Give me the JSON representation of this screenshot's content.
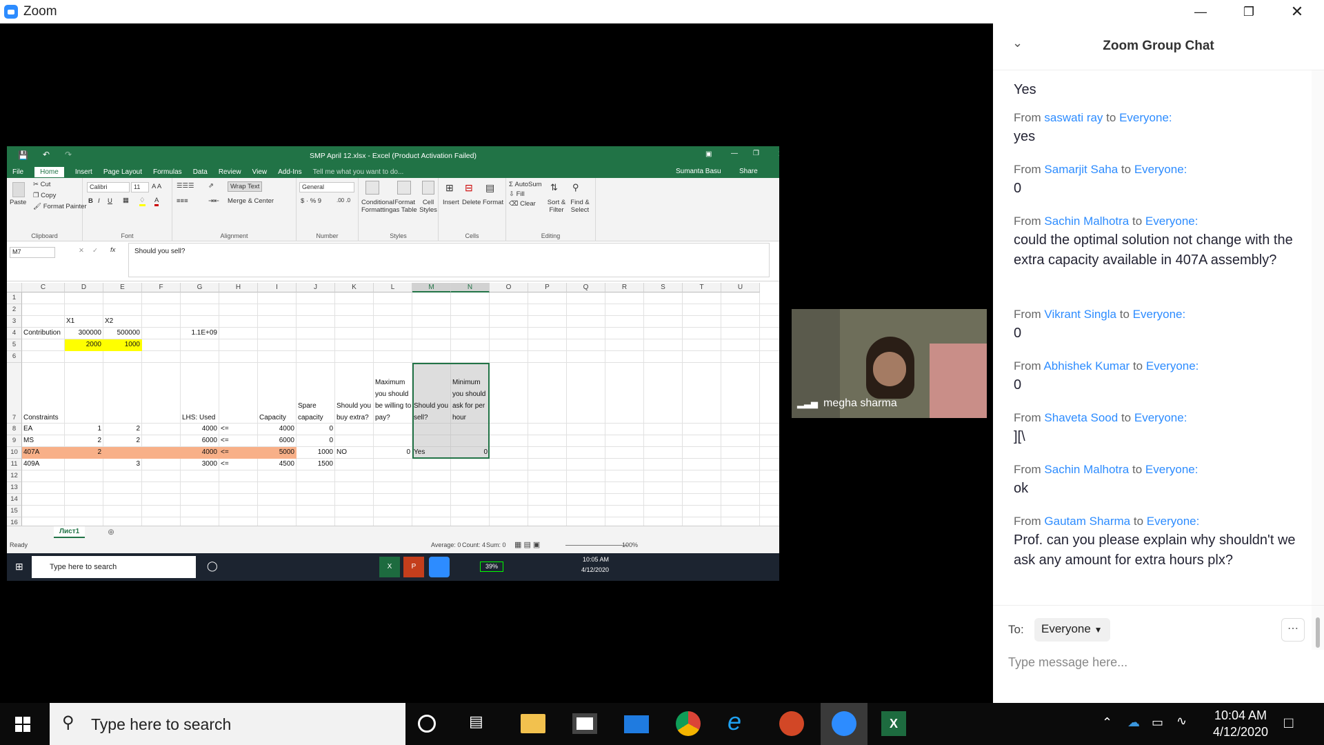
{
  "window": {
    "app_title": "Zoom"
  },
  "excel": {
    "title": "SMP April 12.xlsx - Excel (Product Activation Failed)",
    "tabs": [
      "File",
      "Home",
      "Insert",
      "Page Layout",
      "Formulas",
      "Data",
      "Review",
      "View",
      "Add-Ins"
    ],
    "tell_me": "Tell me what you want to do...",
    "user": "Sumanta Basu",
    "share": "Share",
    "ribbon": {
      "clipboard": {
        "paste": "Paste",
        "cut": "Cut",
        "copy": "Copy",
        "format_painter": "Format Painter",
        "label": "Clipboard"
      },
      "font": {
        "name": "Calibri",
        "size": "11",
        "label": "Font"
      },
      "alignment": {
        "wrap": "Wrap Text",
        "merge": "Merge & Center",
        "label": "Alignment"
      },
      "number": {
        "format": "General",
        "label": "Number"
      },
      "styles": {
        "cond": "Conditional Formatting",
        "table": "Format as Table",
        "cell": "Cell Styles",
        "label": "Styles"
      },
      "cells": {
        "insert": "Insert",
        "delete": "Delete",
        "format": "Format",
        "label": "Cells"
      },
      "editing": {
        "autosum": "AutoSum",
        "fill": "Fill",
        "clear": "Clear",
        "sort": "Sort & Filter",
        "find": "Find & Select",
        "label": "Editing"
      }
    },
    "name_box": "M7",
    "formula": "Should you sell?",
    "columns": [
      "C",
      "D",
      "E",
      "F",
      "G",
      "H",
      "I",
      "J",
      "K",
      "L",
      "M",
      "N",
      "O",
      "P",
      "Q",
      "R",
      "S",
      "T",
      "U"
    ],
    "rows": [
      "1",
      "2",
      "3",
      "4",
      "5",
      "6",
      "7",
      "8",
      "9",
      "10",
      "11",
      "12",
      "13",
      "14",
      "15",
      "16"
    ],
    "cells": {
      "D3": "X1",
      "E3": "X2",
      "C4": "Contribution",
      "D4": "300000",
      "E4": "500000",
      "G4": "1.1E+09",
      "D5": "2000",
      "E5": "1000",
      "C7": "Constraints",
      "G7": "LHS: Used",
      "I7": "Capacity",
      "J7": "Spare capacity",
      "K7": "Should you buy extra?",
      "L7": "Maximum you should be willing to pay?",
      "M7": "Should you sell?",
      "N7": "Minimum you should ask for per hour",
      "C8": "EA",
      "D8": "1",
      "E8": "2",
      "G8": "4000",
      "H8": "<=",
      "I8": "4000",
      "J8": "0",
      "C9": "MS",
      "D9": "2",
      "E9": "2",
      "G9": "6000",
      "H9": "<=",
      "I9": "6000",
      "J9": "0",
      "C10": "407A",
      "D10": "2",
      "G10": "4000",
      "H10": "<=",
      "I10": "5000",
      "J10": "1000",
      "K10": "NO",
      "L10": "0",
      "M10": "Yes",
      "N10": "0",
      "C11": "409A",
      "E11": "3",
      "G11": "3000",
      "H11": "<=",
      "I11": "4500",
      "J11": "1500"
    },
    "sheet_tab": "Лист1",
    "status": {
      "ready": "Ready",
      "average": "Average: 0",
      "count": "Count: 4",
      "sum": "Sum: 0",
      "zoom": "100%"
    },
    "taskbar": {
      "search": "Type here to search",
      "battery": "39%",
      "time": "10:05 AM",
      "date": "4/12/2020"
    },
    "colors": {
      "green": "#217346",
      "yellow": "#FFFF00",
      "orange": "#F8B088"
    }
  },
  "video": {
    "name": "megha sharma"
  },
  "chat": {
    "title": "Zoom Group Chat",
    "first_body": "Yes",
    "messages": [
      {
        "from": "saswati ray",
        "to": "Everyone:",
        "body": "yes"
      },
      {
        "from": "Samarjit Saha",
        "to": "Everyone:",
        "body": "0"
      },
      {
        "from": "Sachin Malhotra",
        "to": "Everyone:",
        "body": "could the optimal solution not change with the extra capacity available in 407A assembly?"
      },
      {
        "from": "Vikrant Singla",
        "to": "Everyone:",
        "body": "0"
      },
      {
        "from": "Abhishek Kumar",
        "to": "Everyone:",
        "body": "0"
      },
      {
        "from": "Shaveta Sood",
        "to": "Everyone:",
        "body": "][\\"
      },
      {
        "from": "Sachin Malhotra",
        "to": "Everyone:",
        "body": "ok"
      },
      {
        "from": "Gautam Sharma",
        "to": "Everyone:",
        "body": "Prof. can you please explain why shouldn't we ask any amount for extra hours plx?"
      }
    ],
    "from_word": "From",
    "to_word": "to",
    "to_label": "To:",
    "recipient": "Everyone",
    "placeholder": "Type message here..."
  },
  "taskbar": {
    "search": "Type here to search",
    "time": "10:04 AM",
    "date": "4/12/2020"
  }
}
